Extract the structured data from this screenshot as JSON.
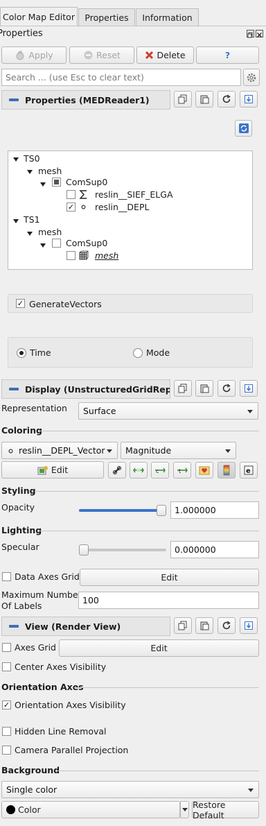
{
  "tabs": [
    {
      "label": "Color Map Editor"
    },
    {
      "label": "Properties"
    },
    {
      "label": "Information"
    }
  ],
  "panel_title": "Properties",
  "toolbar": {
    "apply": "Apply",
    "reset": "Reset",
    "delete": "Delete",
    "help": "?"
  },
  "search": {
    "placeholder": "Search ... (use Esc to clear text)"
  },
  "properties_section": {
    "title": "Properties (MEDReader1)"
  },
  "tree": {
    "ts0": "TS0",
    "mesh0": "mesh",
    "comsup0_a": "ComSup0",
    "field_sief": "reslin__SIEF_ELGA",
    "field_depl": "reslin__DEPL",
    "ts1": "TS1",
    "mesh1": "mesh",
    "comsup0_b": "ComSup0",
    "mesh_leaf": "mesh"
  },
  "generate_vectors": {
    "label": "GenerateVectors",
    "checked": true
  },
  "time_mode": {
    "time": "Time",
    "mode": "Mode",
    "selected": "Time"
  },
  "display_section": {
    "title": "Display (UnstructuredGridReprese"
  },
  "representation": {
    "label": "Representation",
    "value": "Surface"
  },
  "coloring": {
    "heading": "Coloring",
    "array": "reslin__DEPL_Vector",
    "component": "Magnitude",
    "edit": "Edit"
  },
  "styling": {
    "heading": "Styling",
    "opacity_label": "Opacity",
    "opacity_value": "1.000000",
    "opacity_fraction": 1.0
  },
  "lighting": {
    "heading": "Lighting",
    "specular_label": "Specular",
    "specular_value": "0.000000",
    "specular_fraction": 0.0
  },
  "data_axes_grid": {
    "label": "Data Axes Grid",
    "edit": "Edit"
  },
  "max_labels": {
    "label_line1": "Maximum Number",
    "label_line2": "Of Labels",
    "value": "100"
  },
  "view_section": {
    "title": "View (Render View)"
  },
  "axes_grid": {
    "label": "Axes Grid",
    "edit": "Edit"
  },
  "center_axes": {
    "label": "Center Axes Visibility"
  },
  "orientation_axes": {
    "heading": "Orientation Axes",
    "visibility_label": "Orientation Axes Visibility"
  },
  "hidden_line": {
    "label": "Hidden Line Removal"
  },
  "camera_parallel": {
    "label": "Camera Parallel Projection"
  },
  "background": {
    "heading": "Background",
    "mode": "Single color",
    "color_label": "Color",
    "restore": "Restore Default"
  },
  "colors": {
    "accent": "#3e6fb5",
    "delete_red": "#d23a2a",
    "help_blue": "#3b74c9"
  }
}
